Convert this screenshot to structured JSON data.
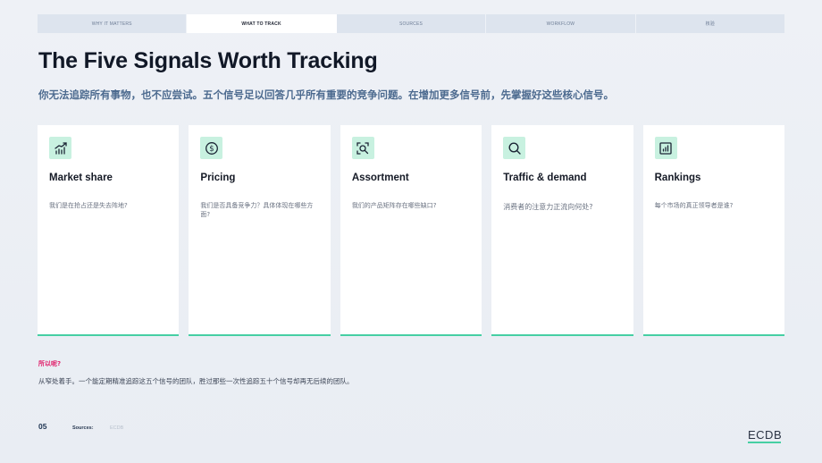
{
  "nav": {
    "tabs": [
      {
        "label": "WHY IT MATTERS",
        "active": false
      },
      {
        "label": "WHAT TO TRACK",
        "active": true
      },
      {
        "label": "SOURCES",
        "active": false
      },
      {
        "label": "WORKFLOW",
        "active": false
      },
      {
        "label": "核验",
        "active": false
      }
    ]
  },
  "header": {
    "title": "The Five Signals Worth Tracking",
    "subtitle": "你无法追踪所有事物，也不应尝试。五个信号足以回答几乎所有重要的竞争问题。在增加更多信号前，先掌握好这些核心信号。"
  },
  "cards": [
    {
      "title": "Market share",
      "text": "我们是在抢占还是失去阵地?",
      "icon": "growth-chart-icon"
    },
    {
      "title": "Pricing",
      "text": "我们是否具备竞争力？具体体现在哪些方面?",
      "icon": "dollar-coin-icon"
    },
    {
      "title": "Assortment",
      "text": "我们的产品矩阵存在哪些缺口?",
      "icon": "product-search-icon"
    },
    {
      "title": "Traffic & demand",
      "text": "消费者的注意力正流向何处?",
      "icon": "search-icon"
    },
    {
      "title": "Rankings",
      "text": "每个市场的真正领导者是谁?",
      "icon": "bar-chart-icon"
    }
  ],
  "footer_note": {
    "question": "所以呢?",
    "answer": "从窄处着手。一个能定期精准追踪这五个信号的团队，胜过那些一次性追踪五十个信号却再无后续的团队。"
  },
  "footer": {
    "page_number": "05",
    "sources_label": "Sources:",
    "sources_value": "ECDB",
    "logo": "ECDB"
  },
  "colors": {
    "accent": "#46cfa3",
    "icon_bg": "#c8f1e0",
    "question": "#e0206b",
    "subtitle": "#4c6a8f"
  }
}
